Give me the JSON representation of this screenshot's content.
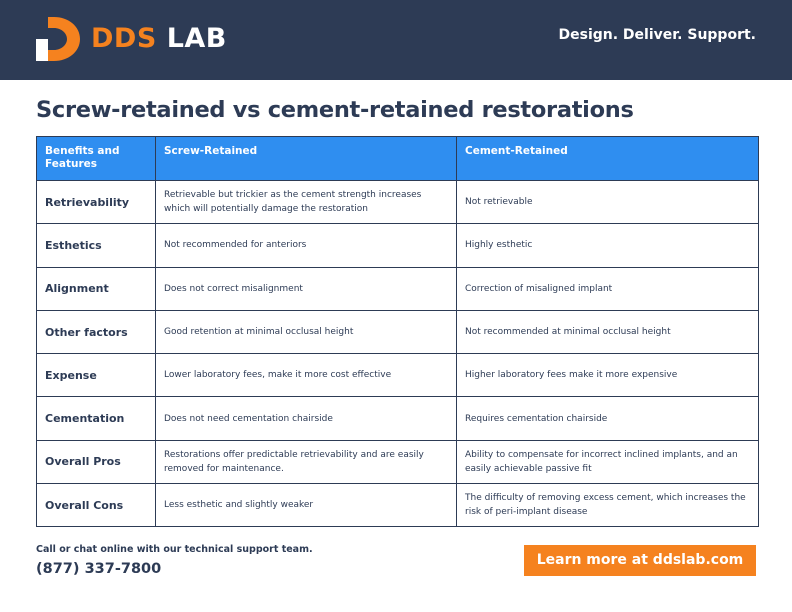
{
  "header": {
    "brand_primary": "DDS",
    "brand_secondary": "LAB",
    "tagline": "Design. Deliver. Support.",
    "brand_color": "#f5821f",
    "background_color": "#2d3b55",
    "logo_icon": "dds-d-logo-icon"
  },
  "title": "Screw-retained vs cement-retained restorations",
  "table": {
    "header_color": "#2f8ef0",
    "columns": [
      "Benefits and Features",
      "Screw-Retained",
      "Cement-Retained"
    ],
    "rows": [
      {
        "feature": "Retrievability",
        "screw": "Retrievable but trickier as the cement strength increases which will potentially damage the restoration",
        "cement": "Not retrievable"
      },
      {
        "feature": "Esthetics",
        "screw": "Not recommended for anteriors",
        "cement": "Highly esthetic"
      },
      {
        "feature": "Alignment",
        "screw": "Does not correct misalignment",
        "cement": "Correction of misaligned implant"
      },
      {
        "feature": "Other factors",
        "screw": "Good retention at minimal occlusal height",
        "cement": "Not recommended at minimal occlusal height"
      },
      {
        "feature": "Expense",
        "screw": "Lower laboratory fees, make it more cost effective",
        "cement": "Higher laboratory fees make it more expensive"
      },
      {
        "feature": "Cementation",
        "screw": "Does not need cementation chairside",
        "cement": "Requires cementation chairside"
      },
      {
        "feature": "Overall Pros",
        "screw": "Restorations offer predictable retrievability and are easily removed for maintenance.",
        "cement": "Ability to compensate for incorrect inclined implants, and an easily achievable passive fit"
      },
      {
        "feature": "Overall Cons",
        "screw": "Less esthetic and slightly weaker",
        "cement": "The difficulty of removing excess cement, which increases the risk of peri-implant disease"
      }
    ]
  },
  "footer": {
    "note": "Call or chat online with our technical support team.",
    "phone": "(877) 337-7800",
    "cta_label": "Learn more at ddslab.com",
    "cta_color": "#f5821f"
  }
}
